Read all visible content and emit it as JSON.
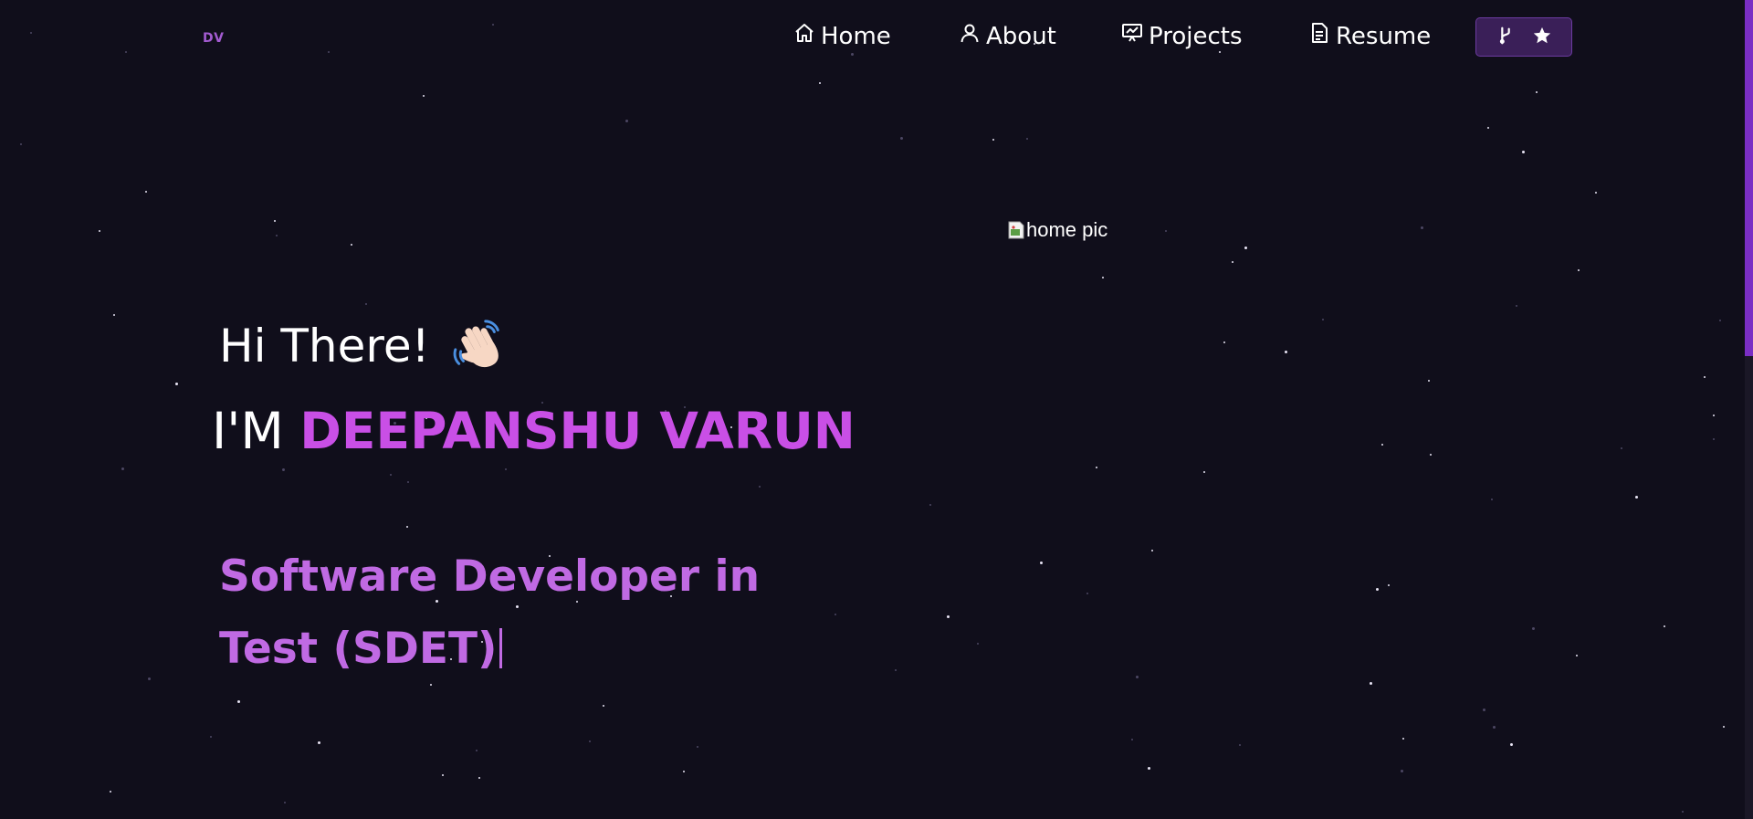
{
  "brand": {
    "logo_text": "DV",
    "accent": "#c94fe6"
  },
  "nav": {
    "items": [
      {
        "label": "Home",
        "icon": "home-icon"
      },
      {
        "label": "About",
        "icon": "user-icon"
      },
      {
        "label": "Projects",
        "icon": "presentation-icon"
      },
      {
        "label": "Resume",
        "icon": "document-icon"
      }
    ],
    "github_button": {
      "icons": [
        "fork-icon",
        "star-icon"
      ],
      "bg": "#3a1f58"
    }
  },
  "hero": {
    "greeting": "Hi There!",
    "greeting_emoji": "waving-hand-icon",
    "intro": "I'M",
    "name": "DEEPANSHU VARUN",
    "role": "Software Developer in Test (SDET)",
    "image_alt": "home pic"
  },
  "colors": {
    "background": "#100e1b",
    "name_color": "#c94fe6",
    "role_color": "#c06ae3",
    "scroll_thumb": "#7a2ec4"
  }
}
